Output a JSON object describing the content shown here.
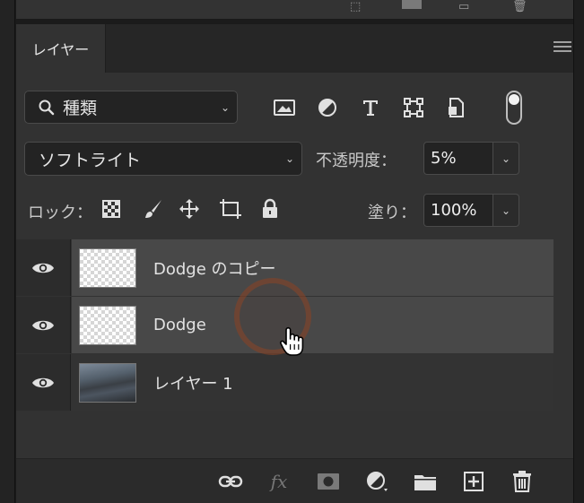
{
  "panel": {
    "tab_label": "レイヤー"
  },
  "filter": {
    "kind_label": "種類",
    "icons": [
      "image-filter-icon",
      "adjustment-filter-icon",
      "type-filter-icon",
      "shape-filter-icon",
      "smart-object-filter-icon",
      "filter-toggle-icon"
    ]
  },
  "blend": {
    "mode": "ソフトライト",
    "opacity_label": "不透明度：",
    "opacity_value": "5%"
  },
  "lock": {
    "label": "ロック：",
    "icons": [
      "lock-transparent-pixels-icon",
      "lock-image-pixels-icon",
      "lock-position-icon",
      "lock-artboard-icon",
      "lock-all-icon"
    ],
    "fill_label": "塗り：",
    "fill_value": "100%"
  },
  "layers": [
    {
      "name": "Dodge のコピー",
      "visible": true,
      "thumbnail": "transparent",
      "selected": true
    },
    {
      "name": "Dodge",
      "visible": true,
      "thumbnail": "transparent",
      "selected": true
    },
    {
      "name": "レイヤー 1",
      "visible": true,
      "thumbnail": "photo",
      "selected": false
    }
  ],
  "footer": {
    "fx_label": "fx",
    "icons": [
      "link-layers-icon",
      "fx-icon",
      "add-mask-icon",
      "new-adjustment-layer-icon",
      "new-group-icon",
      "new-layer-icon",
      "delete-layer-icon"
    ]
  },
  "colors": {
    "panel_bg": "#323232",
    "selected_row": "#484848",
    "row_bg": "#333333",
    "input_bg": "#232323"
  }
}
